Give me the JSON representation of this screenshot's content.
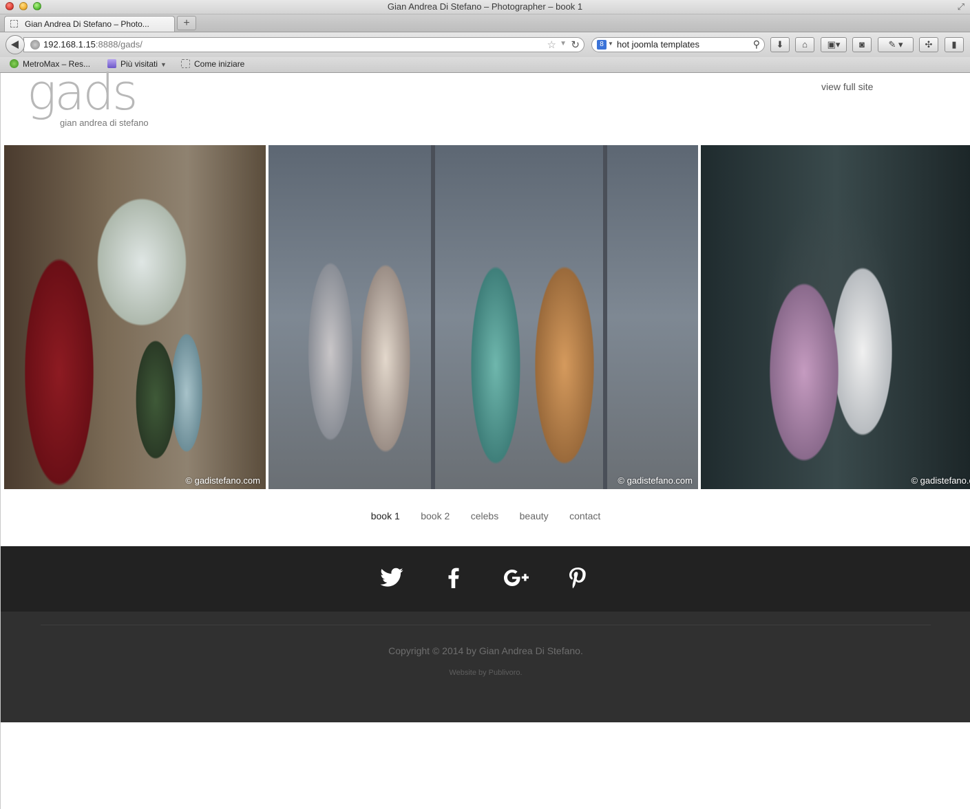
{
  "window": {
    "title": "Gian Andrea Di Stefano – Photographer – book 1"
  },
  "tabs": [
    {
      "label": "Gian Andrea Di Stefano – Photo..."
    }
  ],
  "address_bar": {
    "url_host": "192.168.1.15",
    "url_rest": ":8888/gads/"
  },
  "search_bar": {
    "value": "hot joomla templates",
    "engine_letter": "8"
  },
  "bookmarks": [
    {
      "label": "MetroMax – Res..."
    },
    {
      "label": "Più visitati"
    },
    {
      "label": "Come iniziare"
    }
  ],
  "site": {
    "logo_text": "gads",
    "logo_subtitle": "gian andrea di stefano",
    "view_full_site": "view full site",
    "gallery": [
      {
        "credit": "© gadistefano.com"
      },
      {
        "credit": "© gadistefano.com"
      },
      {
        "credit": "© gadistefano.c"
      }
    ],
    "nav": [
      {
        "label": "book 1",
        "active": true
      },
      {
        "label": "book 2"
      },
      {
        "label": "celebs"
      },
      {
        "label": "beauty"
      },
      {
        "label": "contact"
      }
    ],
    "social": [
      {
        "icon": "twitter-icon"
      },
      {
        "icon": "facebook-icon"
      },
      {
        "icon": "google-plus-icon"
      },
      {
        "icon": "pinterest-icon"
      }
    ],
    "footer": {
      "copyright": "Copyright © 2014 by Gian Andrea Di Stefano.",
      "credit": "Website by Publivoro."
    }
  },
  "colors": {
    "social_band": "#222222",
    "footer_bg": "#303030"
  }
}
